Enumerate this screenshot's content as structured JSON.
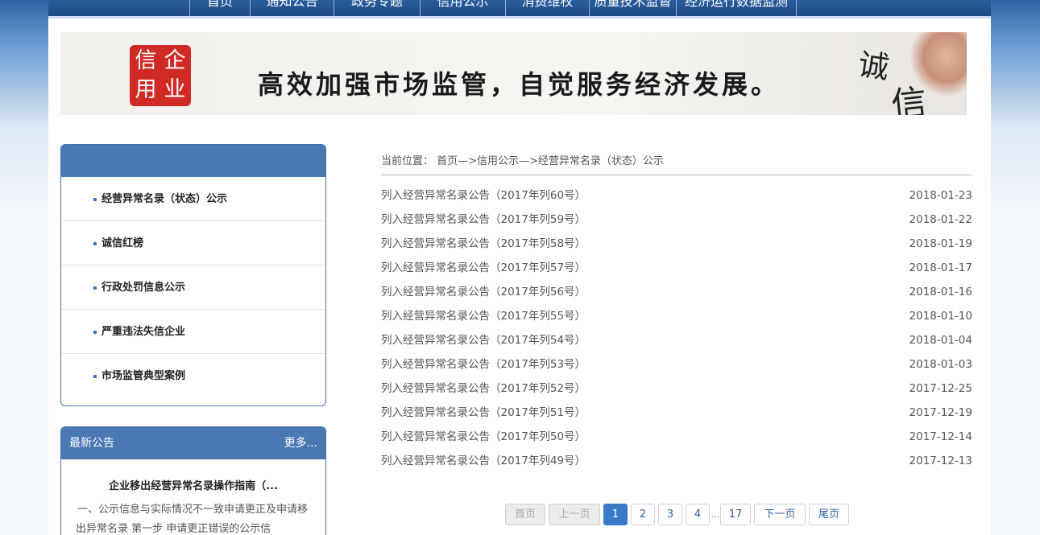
{
  "nav": {
    "items": [
      "首页",
      "通知公告",
      "政务专题",
      "信用公示",
      "消费维权",
      "质量技术监督",
      "经济运行数据监测"
    ]
  },
  "banner": {
    "seal_chars": [
      "信",
      "企",
      "用",
      "业"
    ],
    "slogan": "高效加强市场监管，自觉服务经济发展。",
    "corner_chars": [
      "诚",
      "信"
    ]
  },
  "side_menu": {
    "items": [
      "经营异常名录（状态）公示",
      "诚信红榜",
      "行政处罚信息公示",
      "严重违法失信企业",
      "市场监管典型案例"
    ]
  },
  "notice": {
    "title": "最新公告",
    "more": "更多...",
    "item_title": "企业移出经营异常名录操作指南（...",
    "item_body": "一、公示信息与实际情况不一致申请更正及申请移出异常名录 第一步 申请更正错误的公示信"
  },
  "breadcrumb": "当前位置： 首页—>信用公示—>经营异常名录（状态）公示",
  "list": [
    {
      "title": "列入经营异常名录公告（2017年列60号）",
      "date": "2018-01-23"
    },
    {
      "title": "列入经营异常名录公告（2017年列59号）",
      "date": "2018-01-22"
    },
    {
      "title": "列入经营异常名录公告（2017年列58号）",
      "date": "2018-01-19"
    },
    {
      "title": "列入经营异常名录公告（2017年列57号）",
      "date": "2018-01-17"
    },
    {
      "title": "列入经营异常名录公告（2017年列56号）",
      "date": "2018-01-16"
    },
    {
      "title": "列入经营异常名录公告（2017年列55号）",
      "date": "2018-01-10"
    },
    {
      "title": "列入经营异常名录公告（2017年列54号）",
      "date": "2018-01-04"
    },
    {
      "title": "列入经营异常名录公告（2017年列53号）",
      "date": "2018-01-03"
    },
    {
      "title": "列入经营异常名录公告（2017年列52号）",
      "date": "2017-12-25"
    },
    {
      "title": "列入经营异常名录公告（2017年列51号）",
      "date": "2017-12-19"
    },
    {
      "title": "列入经营异常名录公告（2017年列50号）",
      "date": "2017-12-14"
    },
    {
      "title": "列入经营异常名录公告（2017年列49号）",
      "date": "2017-12-13"
    }
  ],
  "pager": {
    "first": "首页",
    "prev": "上一页",
    "pages": [
      "1",
      "2",
      "3",
      "4"
    ],
    "ellipsis": "...",
    "last_page": "17",
    "next": "下一页",
    "last": "尾页",
    "current": "1"
  },
  "colors": {
    "nav": "#1e4a86",
    "panel_header": "#4a78b3",
    "active_page": "#3a7bc8",
    "seal": "#cf2a24"
  }
}
